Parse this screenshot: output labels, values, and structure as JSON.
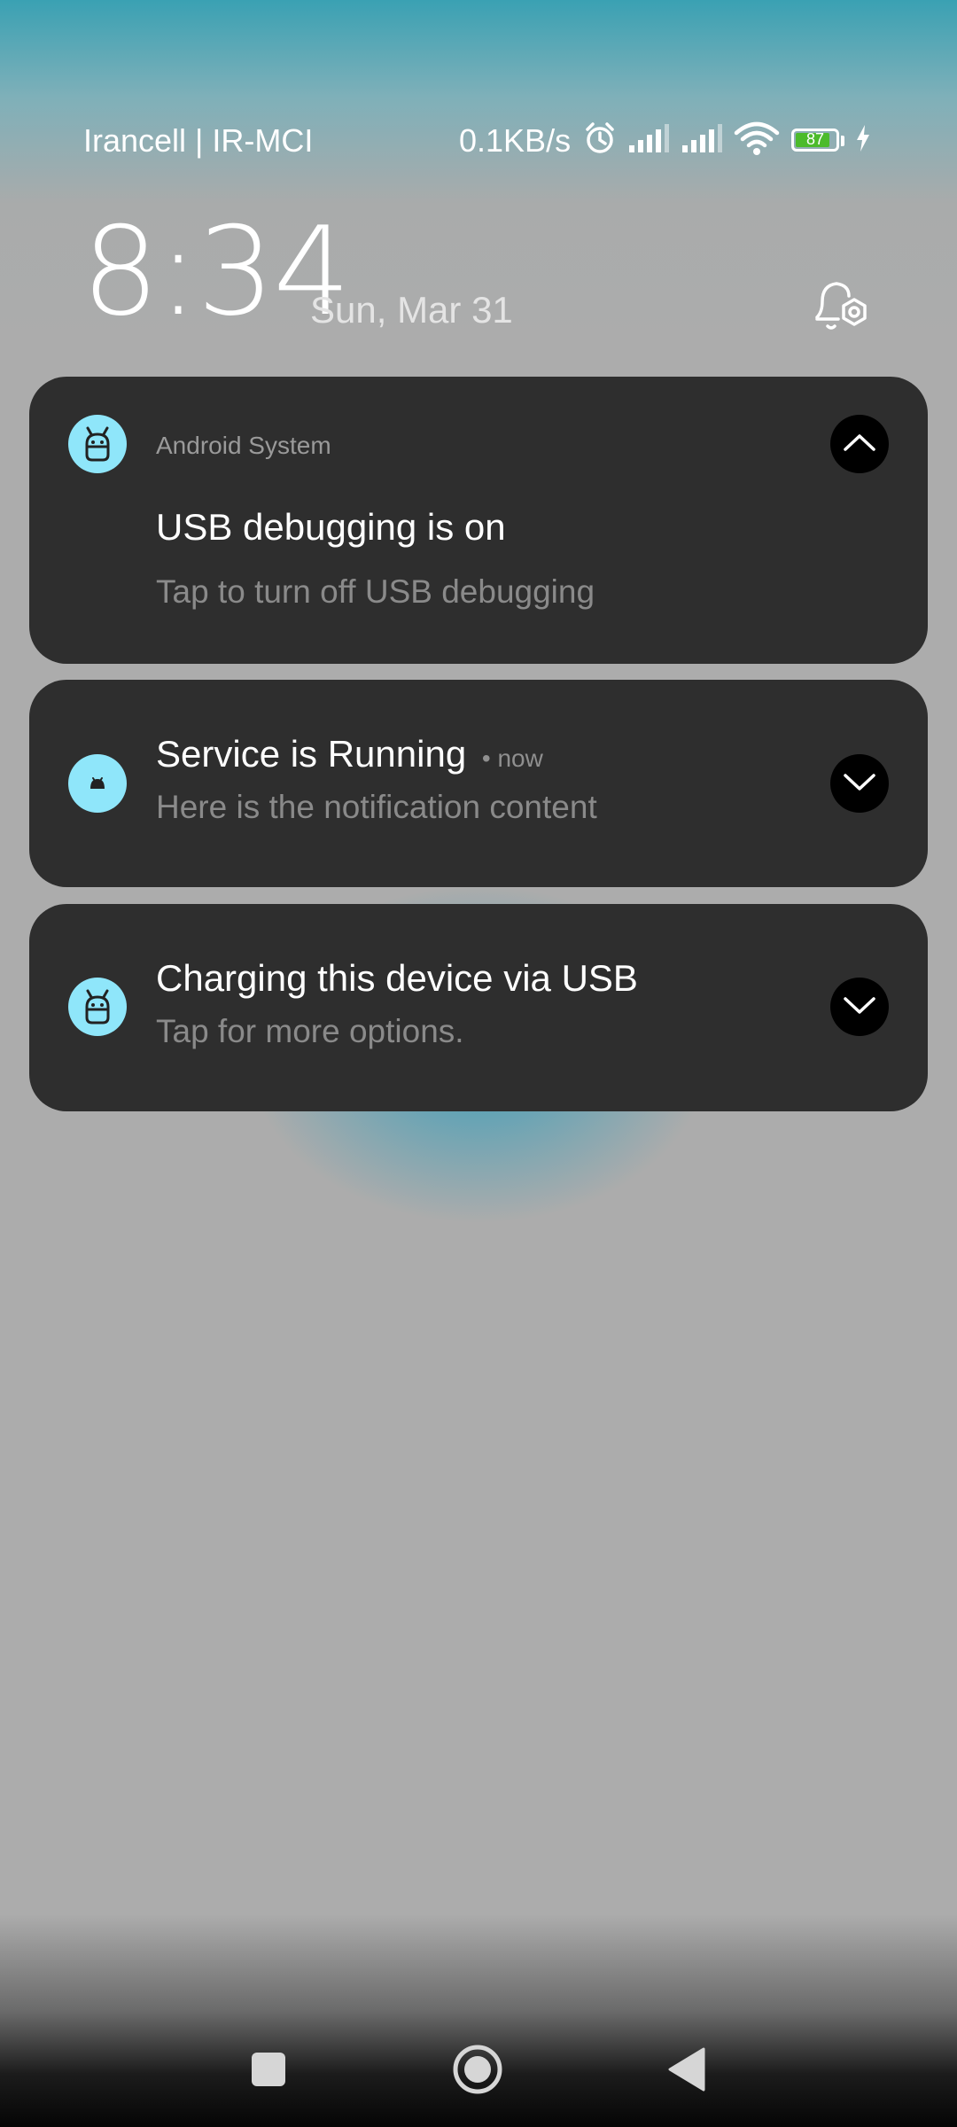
{
  "status_bar": {
    "carrier": "Irancell | IR-MCI",
    "net_speed": "0.1KB/s",
    "battery_level": "87",
    "battery_fraction": 0.87,
    "icons": [
      "alarm-icon",
      "signal-icon-sim1",
      "signal-icon-sim2",
      "wifi-icon",
      "battery-icon",
      "charging-bolt-icon"
    ],
    "battery_color": "#4cbb2b"
  },
  "lock": {
    "time": "8:34",
    "date": "Sun, Mar 31"
  },
  "notifications": [
    {
      "app_name": "Android System",
      "title": "USB debugging is on",
      "text": "Tap to turn off USB debugging",
      "expanded": true,
      "icon": "android-system-icon"
    },
    {
      "title": "Service is Running",
      "time": "now",
      "text": "Here is the notification content",
      "expanded": false,
      "icon": "android-app-icon"
    },
    {
      "title": "Charging this device via USB",
      "text": "Tap for more options.",
      "expanded": false,
      "icon": "android-system-icon"
    }
  ],
  "nav": {
    "buttons": [
      "recents-button",
      "home-button",
      "back-button"
    ]
  },
  "colors": {
    "card_bg": "#2e2e2e",
    "icon_accent": "#8fe6fa"
  }
}
